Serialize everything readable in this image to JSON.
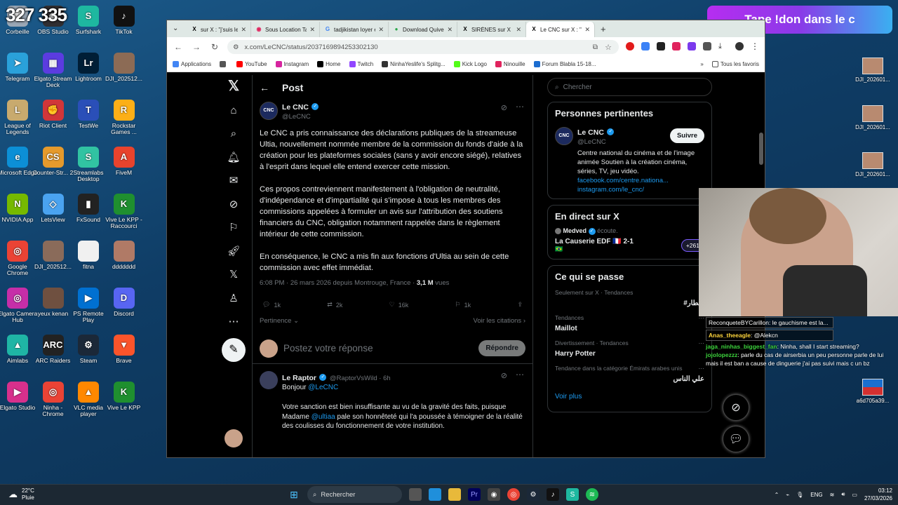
{
  "overlay": {
    "counter": "327 335",
    "banner": "Tape !don dans le c"
  },
  "desktop_icons": [
    {
      "label": "Corbeille",
      "color": "#9aa7b5",
      "glyph": "🗑"
    },
    {
      "label": "OBS Studio",
      "color": "#302e31",
      "glyph": "◉"
    },
    {
      "label": "Surfshark",
      "color": "#1eb8a0",
      "glyph": "S"
    },
    {
      "label": "TikTok",
      "color": "#111111",
      "glyph": "♪"
    },
    {
      "label": "Telegram",
      "color": "#2aa1da",
      "glyph": "➤"
    },
    {
      "label": "Elgato Stream Deck",
      "color": "#5b3ce0",
      "glyph": "▦"
    },
    {
      "label": "Lightroom",
      "color": "#001e36",
      "glyph": "Lr"
    },
    {
      "label": "DJI_202512...",
      "color": "#8c6b55",
      "glyph": ""
    },
    {
      "label": "League of Legends",
      "color": "#c8aa6e",
      "glyph": "L"
    },
    {
      "label": "Riot Client",
      "color": "#d13639",
      "glyph": "✊"
    },
    {
      "label": "TestWe",
      "color": "#2a4fb8",
      "glyph": "T"
    },
    {
      "label": "Rockstar Games ...",
      "color": "#fcaf17",
      "glyph": "R"
    },
    {
      "label": "Microsoft Edge",
      "color": "#0c8fd6",
      "glyph": "e"
    },
    {
      "label": "Counter-Str... 2",
      "color": "#e59a2c",
      "glyph": "CS"
    },
    {
      "label": "Streamlabs Desktop",
      "color": "#31c3a2",
      "glyph": "S"
    },
    {
      "label": "FiveM",
      "color": "#e8432d",
      "glyph": "A"
    },
    {
      "label": "NVIDIA App",
      "color": "#76b900",
      "glyph": "N"
    },
    {
      "label": "LetsView",
      "color": "#4aa3f0",
      "glyph": "◇"
    },
    {
      "label": "FxSound",
      "color": "#222222",
      "glyph": "▮"
    },
    {
      "label": "Vive Le KPP - Raccourci",
      "color": "#1f8f2f",
      "glyph": "K"
    },
    {
      "label": "Google Chrome",
      "color": "#ea4335",
      "glyph": "◎"
    },
    {
      "label": "DJI_202512...",
      "color": "#8a6b5a",
      "glyph": ""
    },
    {
      "label": "fitna",
      "color": "#f0f0f0",
      "glyph": ""
    },
    {
      "label": "ddddddd",
      "color": "#b07a66",
      "glyph": ""
    },
    {
      "label": "Elgato Camera Hub",
      "color": "#c62ea8",
      "glyph": "◎"
    },
    {
      "label": "yeux kenan",
      "color": "#6f5040",
      "glyph": ""
    },
    {
      "label": "PS Remote Play",
      "color": "#0070d1",
      "glyph": "▶"
    },
    {
      "label": "Discord",
      "color": "#5865f2",
      "glyph": "D"
    },
    {
      "label": "Aimlabs",
      "color": "#1fb5a5",
      "glyph": "▲"
    },
    {
      "label": "ARC Raiders",
      "color": "#222222",
      "glyph": "ARC"
    },
    {
      "label": "Steam",
      "color": "#1b2838",
      "glyph": "⚙"
    },
    {
      "label": "Brave",
      "color": "#fb542b",
      "glyph": "▼"
    },
    {
      "label": "Elgato Studio",
      "color": "#d7308c",
      "glyph": "▶"
    },
    {
      "label": "Ninha - Chrome",
      "color": "#ea4335",
      "glyph": "◎"
    },
    {
      "label": "VLC media player",
      "color": "#ff8800",
      "glyph": "▲"
    },
    {
      "label": "Vive Le KPP",
      "color": "#1f8f2f",
      "glyph": "K"
    }
  ],
  "right_icons": [
    {
      "label": "DJI_202601..."
    },
    {
      "label": "DJI_202601..."
    },
    {
      "label": "DJI_202601..."
    },
    {
      "label": "a6d705a39..."
    }
  ],
  "browser": {
    "tabs": [
      {
        "label": "sur X : \"j'suis le",
        "fav": "X",
        "color": "#000000",
        "close": "✕"
      },
      {
        "label": "Sous Location Tadj",
        "fav": "◉",
        "color": "#e0245e",
        "close": "✕"
      },
      {
        "label": "tadjikistan loyer en",
        "fav": "G",
        "color": "#4285f4",
        "close": "✕"
      },
      {
        "label": "Download Quivec",
        "fav": "●",
        "color": "#2aa84a",
        "close": "✕"
      },
      {
        "label": "SIRÈNES sur X : \"",
        "fav": "X",
        "color": "#000000",
        "close": "✕"
      },
      {
        "label": "Le CNC sur X : \"Le",
        "fav": "X",
        "color": "#000000",
        "close": "✕"
      }
    ],
    "new_tab": "+",
    "url": "x.com/LeCNC/status/2037169894253302130",
    "bookmarks": [
      {
        "label": "Applications",
        "color": "#4285f4"
      },
      {
        "label": "",
        "color": "#555555"
      },
      {
        "label": "YouTube",
        "color": "#ff0000"
      },
      {
        "label": "Instagram",
        "color": "#d6249f"
      },
      {
        "label": "Home",
        "color": "#000000"
      },
      {
        "label": "Twitch",
        "color": "#9146ff"
      },
      {
        "label": "NinhaYeslife's Splitg...",
        "color": "#333333"
      },
      {
        "label": "Kick Logo",
        "color": "#53fc18"
      },
      {
        "label": "Ninouille",
        "color": "#e0245e"
      },
      {
        "label": "Forum Blabla 15-18...",
        "color": "#1c6dd0"
      }
    ],
    "all_bookmarks": "Tous les favoris"
  },
  "x": {
    "header": "Post",
    "post": {
      "name": "Le CNC",
      "handle": "@LeCNC",
      "avatar_text": "CNC",
      "paragraphs": [
        "Le CNC a pris connaissance des déclarations publiques de la streameuse Ultia, nouvellement nommée membre de la commission du fonds d'aide à la création pour les plateformes sociales (sans y avoir encore siégé), relatives à l'esprit dans lequel elle entend exercer cette mission.",
        "Ces propos contreviennent manifestement à l'obligation de neutralité, d'indépendance et d'impartialité qui s'impose à tous les membres des commissions appelées à formuler un avis sur l'attribution des soutiens financiers du CNC, obligation notamment rappelée dans le règlement intérieur de cette commission.",
        "En conséquence, le CNC a mis fin aux fonctions d'Ultia au sein de cette commission avec effet immédiat."
      ],
      "meta": "6:08 PM · 26 mars 2026 depuis Montrouge, France · ",
      "views": "3,1 M",
      "views_label": " vues",
      "replies": "1k",
      "reposts": "2k",
      "likes": "16k",
      "bookmarks": "1k",
      "relevance": "Pertinence",
      "quotes": "Voir les citations"
    },
    "reply_placeholder": "Postez votre réponse",
    "reply_button": "Répondre",
    "reply": {
      "name": "Le Raptor",
      "handle": "@RaptorVsWild · 6h",
      "greeting": "Bonjour ",
      "mention": "@LeCNC",
      "text1": "Votre sanction est bien insuffisante au vu de la gravité des faits, puisque Madame ",
      "mention2": "@ultiaa",
      "text2": " pale son honnêteté qui l'a poussée à témoigner de la réalité des coulisses du fonctionnement de votre institution."
    },
    "search_placeholder": "Chercher",
    "relevant": {
      "title": "Personnes pertinentes",
      "name": "Le CNC",
      "handle": "@LeCNC",
      "follow": "Suivre",
      "bio": "Centre national du cinéma et de l'image animée Soutien à la création cinéma, séries, TV, jeu vidéo.",
      "link1": "facebook.com/centre.nationa...",
      "link2": "instagram.com/le_cnc/"
    },
    "live": {
      "title": "En direct sur X",
      "host": "Medved",
      "status": "écoute.",
      "event": "La Causerie EDF 🇫🇷 2-1",
      "flag": "🇧🇷",
      "count": "+261"
    },
    "happening": {
      "title": "Ce qui se passe",
      "trends": [
        {
          "cat": "Seulement sur X · Tendances",
          "name": "#أمطار",
          "rtl": true
        },
        {
          "cat": "Tendances",
          "name": "Maillot",
          "rtl": false
        },
        {
          "cat": "Divertissement · Tendances",
          "name": "Harry Potter",
          "rtl": false
        },
        {
          "cat": "Tendance dans la catégorie Émirats arabes unis",
          "name": "علي الناس",
          "rtl": true
        }
      ],
      "more": "Voir plus"
    }
  },
  "chat": {
    "highlight1": "ReconqueteBYCarillon: le gauchisme est la...",
    "highlight2_user": "Anas_theeagle",
    "highlight2_text": ": @Alekcn",
    "lines": [
      {
        "user": "jaga_ninhas_biggest_fan",
        "text": ": Ninha, shall I start streaming?",
        "cls": "u1"
      },
      {
        "user": "jojolopezzz",
        "text": ": parle du cas de airserbia un peu personne parle de lui mais il est ban a cause de dinguerie j'ai pas suivi mais c un bz",
        "cls": "u1"
      }
    ]
  },
  "taskbar": {
    "temp": "22°C",
    "weather": "Pluie",
    "search": "Rechercher",
    "lang": "ENG",
    "time": "03:12",
    "date": "27/03/2026"
  }
}
